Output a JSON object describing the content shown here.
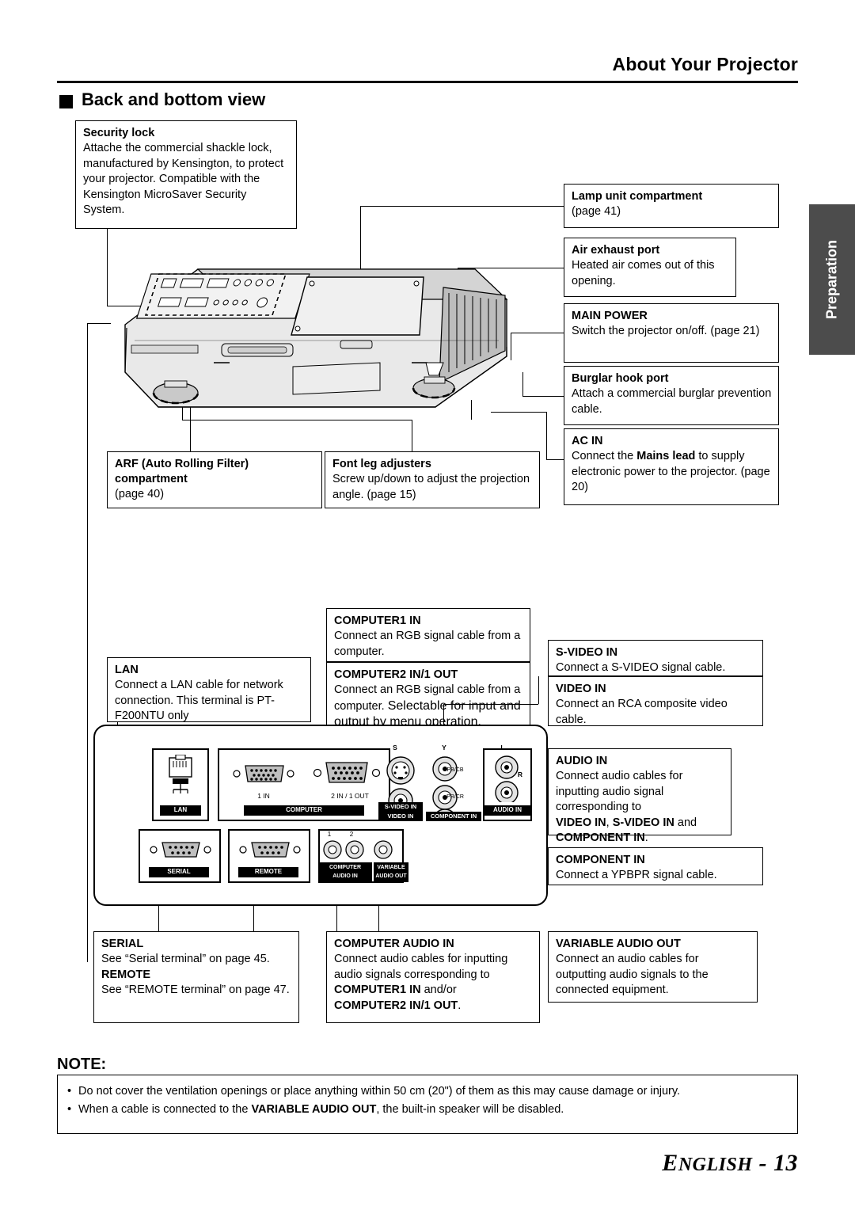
{
  "header": {
    "title": "About Your Projector",
    "section_marker": "black-square",
    "section_title": "Back and bottom view",
    "side_tab": "Preparation"
  },
  "callouts": {
    "security_lock": {
      "title": "Security lock",
      "body": "Attache the commercial shackle lock, manufactured by Kensington, to protect your projector. Compatible with the Kensington MicroSaver Security System."
    },
    "lamp_unit": {
      "title": "Lamp unit compartment",
      "body": "(page 41)"
    },
    "air_exhaust": {
      "title": "Air exhaust port",
      "body": "Heated air comes out of this opening."
    },
    "main_power": {
      "title": "MAIN POWER",
      "body": "Switch the projector on/off. (page 21)"
    },
    "burglar_hook": {
      "title": "Burglar hook port",
      "body": "Attach a commercial burglar prevention cable."
    },
    "ac_in": {
      "title": "AC IN",
      "body_1": "Connect the ",
      "body_b": "Mains lead",
      "body_2": " to supply electronic power to the projector. (page 20)"
    },
    "arf": {
      "title_1": "ARF (Auto Rolling Filter)",
      "title_2": "compartment",
      "body": "(page 40)"
    },
    "font_leg": {
      "title": "Font leg adjusters",
      "body": "Screw up/down to adjust the projection angle. (page 15)"
    },
    "computer1_in": {
      "title": "COMPUTER1 IN",
      "body": "Connect an RGB signal cable from a computer."
    },
    "computer2_in": {
      "title": "COMPUTER2 IN/1 OUT",
      "body_1": "Connect an RGB signal cable from a computer. ",
      "body_2": "Selectable for input and output by menu operation."
    },
    "lan": {
      "title": "LAN",
      "body": "Connect a LAN cable for network connection. This terminal is PT-F200NTU only"
    },
    "svideo_in": {
      "title": "S-VIDEO IN",
      "body": "Connect a S-VIDEO signal cable."
    },
    "video_in": {
      "title": "VIDEO IN",
      "body": "Connect an RCA composite video cable."
    },
    "audio_in": {
      "title": "AUDIO IN",
      "body": "Connect audio cables for inputting audio signal corresponding to",
      "emph_1": "VIDEO IN",
      "mid_1": ", ",
      "emph_2": "S-VIDEO IN",
      "mid_2": " and",
      "emph_3": "COMPONENT IN",
      "mid_3": "."
    },
    "component_in": {
      "title": "COMPONENT IN",
      "body": "Connect a YPBPR signal cable."
    },
    "serial": {
      "title": "SERIAL",
      "body": "See “Serial terminal” on page 45."
    },
    "remote": {
      "title": "REMOTE",
      "body": "See “REMOTE terminal” on page 47."
    },
    "computer_audio_in": {
      "title": "COMPUTER AUDIO IN",
      "body": "Connect audio cables for inputting audio signals corresponding to",
      "emph_1": "COMPUTER1 IN",
      "mid_1": " and/or",
      "emph_2": "COMPUTER2 IN/1 OUT",
      "mid_2": "."
    },
    "variable_audio_out": {
      "title": "VARIABLE AUDIO OUT",
      "body": "Connect an audio cables for outputting audio signals to the connected equipment."
    }
  },
  "panel_labels": {
    "lan": "LAN",
    "computer": "COMPUTER",
    "computer_1in": "1 IN",
    "computer_2in1out": "2 IN / 1 OUT",
    "serial": "SERIAL",
    "remote": "REMOTE",
    "s_video_in": "S-VIDEO IN",
    "video_in": "VIDEO IN",
    "audio_in": "AUDIO IN",
    "component_in": "COMPONENT IN",
    "computer_audio_in": "COMPUTER\nAUDIO IN",
    "variable_audio_out": "VARIABLE\nAUDIO OUT",
    "s": "S",
    "y": "Y",
    "l": "L",
    "r": "R",
    "pb_cb": "PB/CB",
    "pr_cr": "PR/CR",
    "one": "1",
    "two": "2"
  },
  "note": {
    "title": "NOTE:",
    "items": [
      {
        "bullet": "•",
        "text": "Do not cover the ventilation openings or place anything within 50 cm (20\") of them as this may cause damage or injury."
      },
      {
        "bullet": "•",
        "pre": "When a cable is connected to the ",
        "emph": "VARIABLE AUDIO OUT",
        "post": ", the built-in speaker will be disabled."
      }
    ]
  },
  "footer": {
    "big": "E",
    "rest": "NGLISH",
    "page": " - 13"
  }
}
